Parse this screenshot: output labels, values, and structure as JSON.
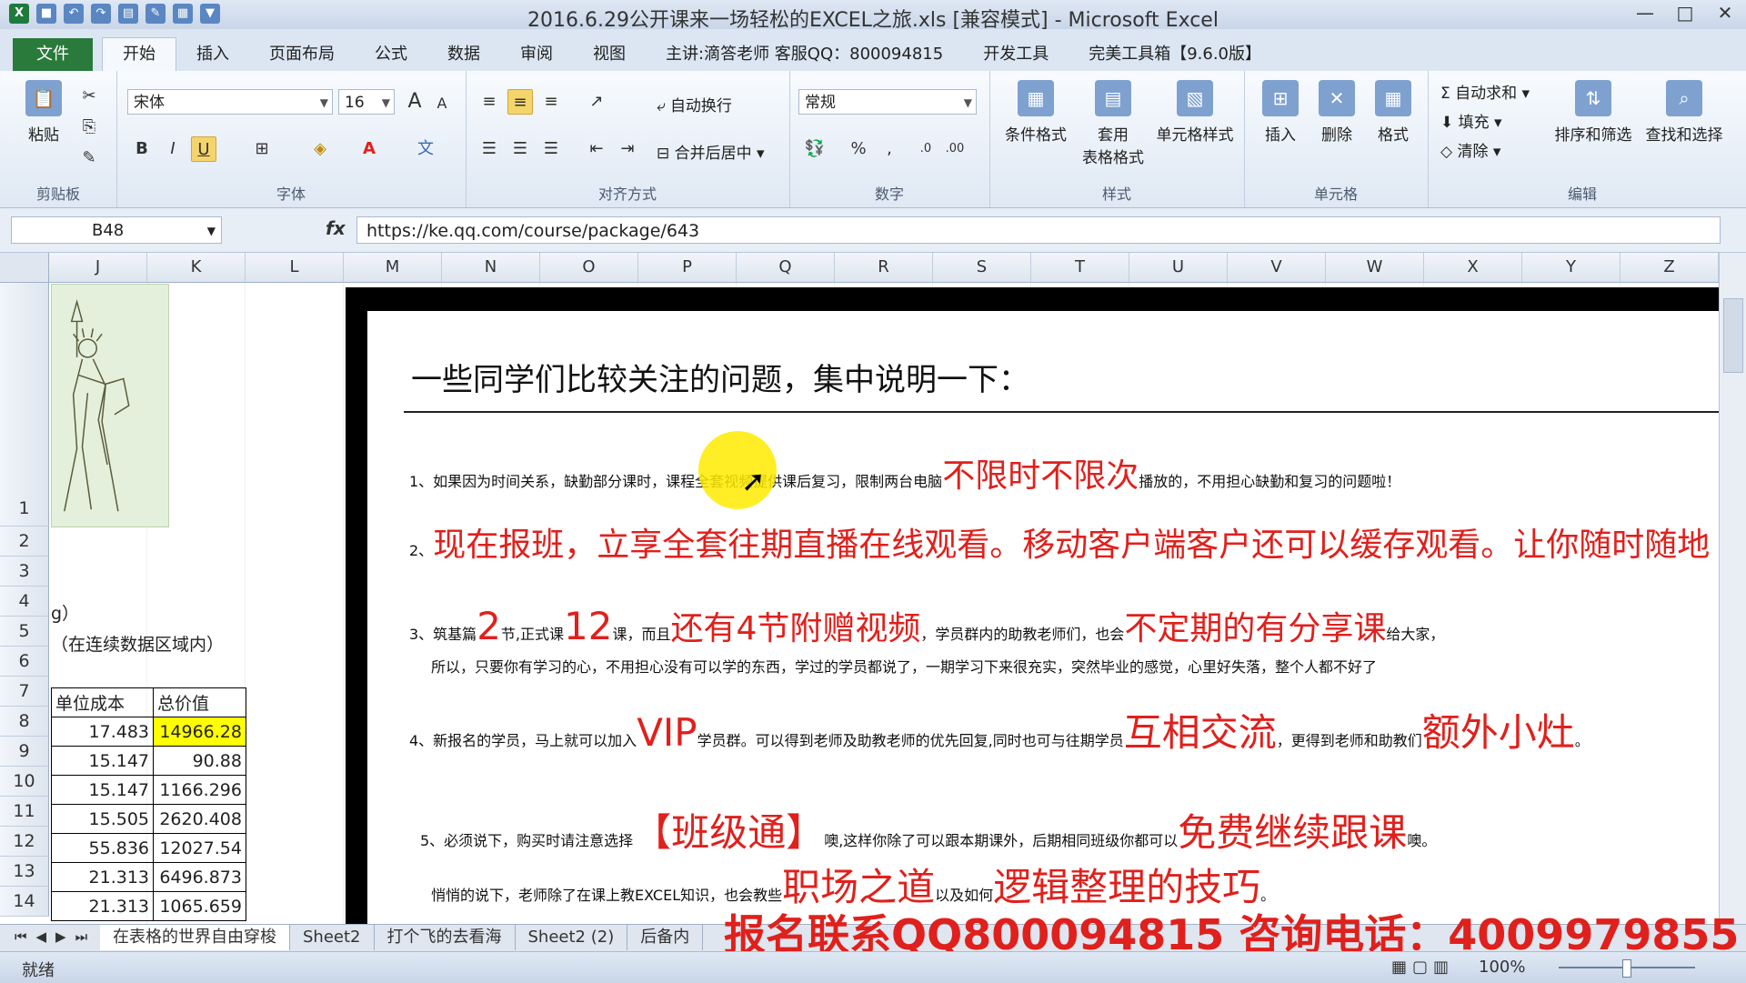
{
  "window": {
    "title": "2016.6.29公开课来一场轻松的EXCEL之旅.xls  [兼容模式] - Microsoft Excel",
    "minimize": "—",
    "maximize": "□",
    "close": "✕"
  },
  "ribbon_tabs": [
    "文件",
    "开始",
    "插入",
    "页面布局",
    "公式",
    "数据",
    "审阅",
    "视图",
    "主讲:滴答老师 客服QQ：800094815",
    "开发工具",
    "完美工具箱【9.6.0版】"
  ],
  "clipboard": {
    "paste": "粘贴",
    "label": "剪贴板"
  },
  "font": {
    "name": "宋体",
    "size": "16",
    "label": "字体",
    "bold": "B",
    "italic": "I",
    "underline": "U",
    "grow": "A",
    "shrink": "A"
  },
  "alignment": {
    "wrap": "自动换行",
    "merge": "合并后居中",
    "label": "对齐方式"
  },
  "number": {
    "format": "常规",
    "label": "数字",
    "percent": "%",
    "comma": ","
  },
  "styles": {
    "conditional": "条件格式",
    "table_l1": "套用",
    "table_l2": "表格格式",
    "cell": "单元格样式",
    "label": "样式"
  },
  "cells": {
    "insert": "插入",
    "delete": "删除",
    "format": "格式",
    "label": "单元格"
  },
  "editing": {
    "autosum": "自动求和",
    "fill": "填充",
    "clear": "清除",
    "sort": "排序和筛选",
    "find": "查找和选择",
    "label": "编辑"
  },
  "formula_bar": {
    "name_box": "B48",
    "fx": "fx",
    "value": "https://ke.qq.com/course/package/643"
  },
  "columns": [
    "J",
    "K",
    "L",
    "M",
    "N",
    "O",
    "P",
    "Q",
    "R",
    "S",
    "T",
    "U",
    "V",
    "W",
    "X",
    "Y",
    "Z"
  ],
  "rows": [
    "1",
    "2",
    "3",
    "4",
    "5",
    "6",
    "7",
    "8",
    "9",
    "10",
    "11",
    "12",
    "13",
    "14"
  ],
  "cells_text": {
    "r4": "g）",
    "r5": "（在连续数据区域内）"
  },
  "table": {
    "headers": [
      "单位成本",
      "总价值"
    ],
    "rows": [
      [
        "17.483",
        "14966.28"
      ],
      [
        "15.147",
        "90.88"
      ],
      [
        "15.147",
        "1166.296"
      ],
      [
        "15.505",
        "2620.408"
      ],
      [
        "55.836",
        "12027.54"
      ],
      [
        "21.313",
        "6496.873"
      ],
      [
        "21.313",
        "1065.659"
      ]
    ]
  },
  "slide": {
    "title": "一些同学们比较关注的问题，集中说明一下：",
    "p1": {
      "a": "1、如果因为时间关系，缺勤部分课时，课程全套视频提供课后复习，限制两台电脑",
      "b": "不限时不限次",
      "c": "播放的，不用担心缺勤和复习的问题啦！"
    },
    "p2": {
      "a": "2、",
      "b": "现在报班，立享全套往期直播在线观看。移动客户端客户还可以缓存观看。让你随时随地"
    },
    "p3": {
      "a": "3、筑基篇",
      "b": "2",
      "c": "节,正式课",
      "d": "12",
      "e": "课，而且",
      "f": "还有4节附赠视频",
      "g": "，学员群内的助教老师们，也会",
      "h": "不定期的有分享课",
      "i": "给大家，"
    },
    "p3b": "所以，只要你有学习的心，不用担心没有可以学的东西，学过的学员都说了，一期学习下来很充实，突然毕业的感觉，心里好失落，整个人都不好了",
    "p4": {
      "a": "4、新报名的学员，马上就可以加入",
      "b": "VIP",
      "c": "学员群。可以得到老师及助教老师的优先回复,同时也可与往期学员",
      "d": "互相交流",
      "e": "，更得到老师和助教们",
      "f": "额外小灶",
      "g": "。"
    },
    "p5": {
      "a": "5、必须说下，购买时请注意选择",
      "b": "【班级通】",
      "c": "噢,这样你除了可以跟本期课外，后期相同班级你都可以",
      "d": "免费继续跟课",
      "e": "噢。"
    },
    "p6": {
      "a": "悄悄的说下，老师除了在课上教EXCEL知识，也会教些",
      "b": "职场之道",
      "c": "以及如何",
      "d": "逻辑整理的技巧",
      "e": "。"
    }
  },
  "banner": "报名联系QQ800094815 咨询电话：4009979855",
  "sheet_tabs": [
    "在表格的世界自由穿梭",
    "Sheet2",
    "打个飞的去看海",
    "Sheet2 (2)",
    "后备内"
  ],
  "status": {
    "ready": "就绪",
    "zoom": "100%"
  },
  "colors": {
    "accent_red": "#e0201c",
    "file_tab": "#2a7a3b",
    "highlight": "#ffff00"
  }
}
